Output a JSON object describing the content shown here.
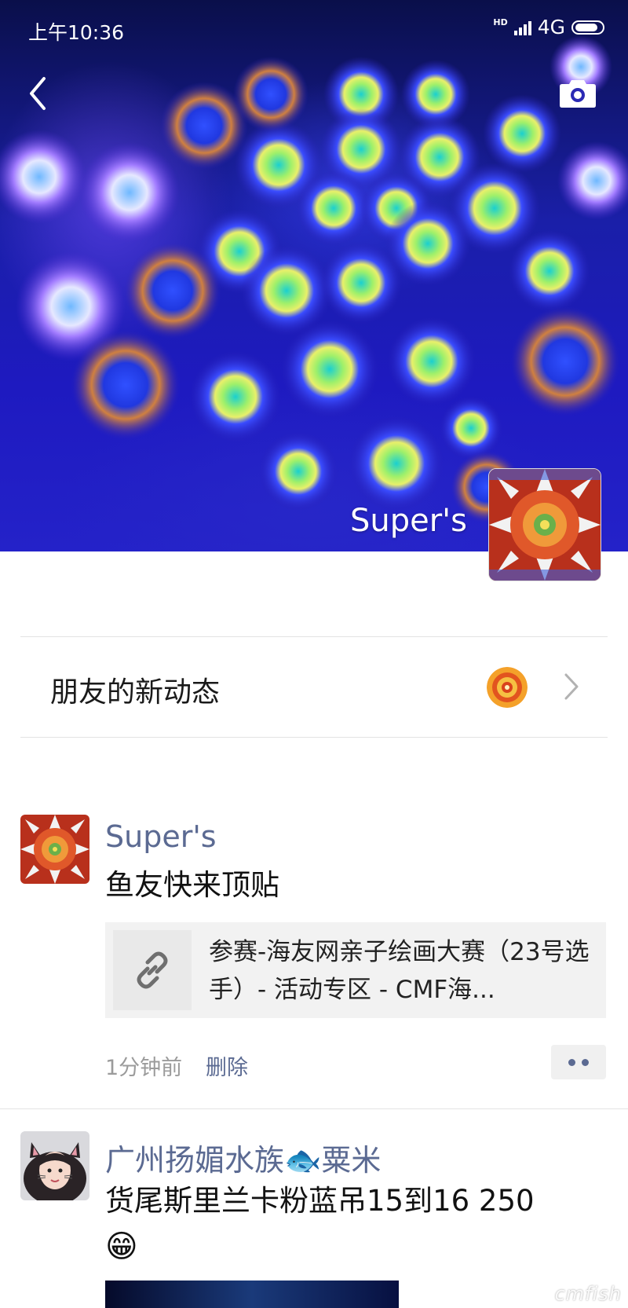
{
  "status_bar": {
    "time": "上午10:36",
    "hd": "HD",
    "network": "4G"
  },
  "cover": {
    "username": "Super's"
  },
  "friends_updates": {
    "label": "朋友的新动态"
  },
  "posts": [
    {
      "author": "Super's",
      "text": "鱼友快来顶贴",
      "link_title": "参赛-海友网亲子绘画大赛（23号选手）- 活动专区 - CMF海...",
      "time": "1分钟前",
      "delete_label": "删除"
    },
    {
      "author": "广州扬媚水族🐟粟米",
      "text": "货尾斯里兰卡粉蓝吊15到16 250",
      "emoji": "😁"
    }
  ],
  "watermark": "cmfish",
  "colors": {
    "link_name": "#5b6a92",
    "cover_blue": "#1e1ac0"
  }
}
